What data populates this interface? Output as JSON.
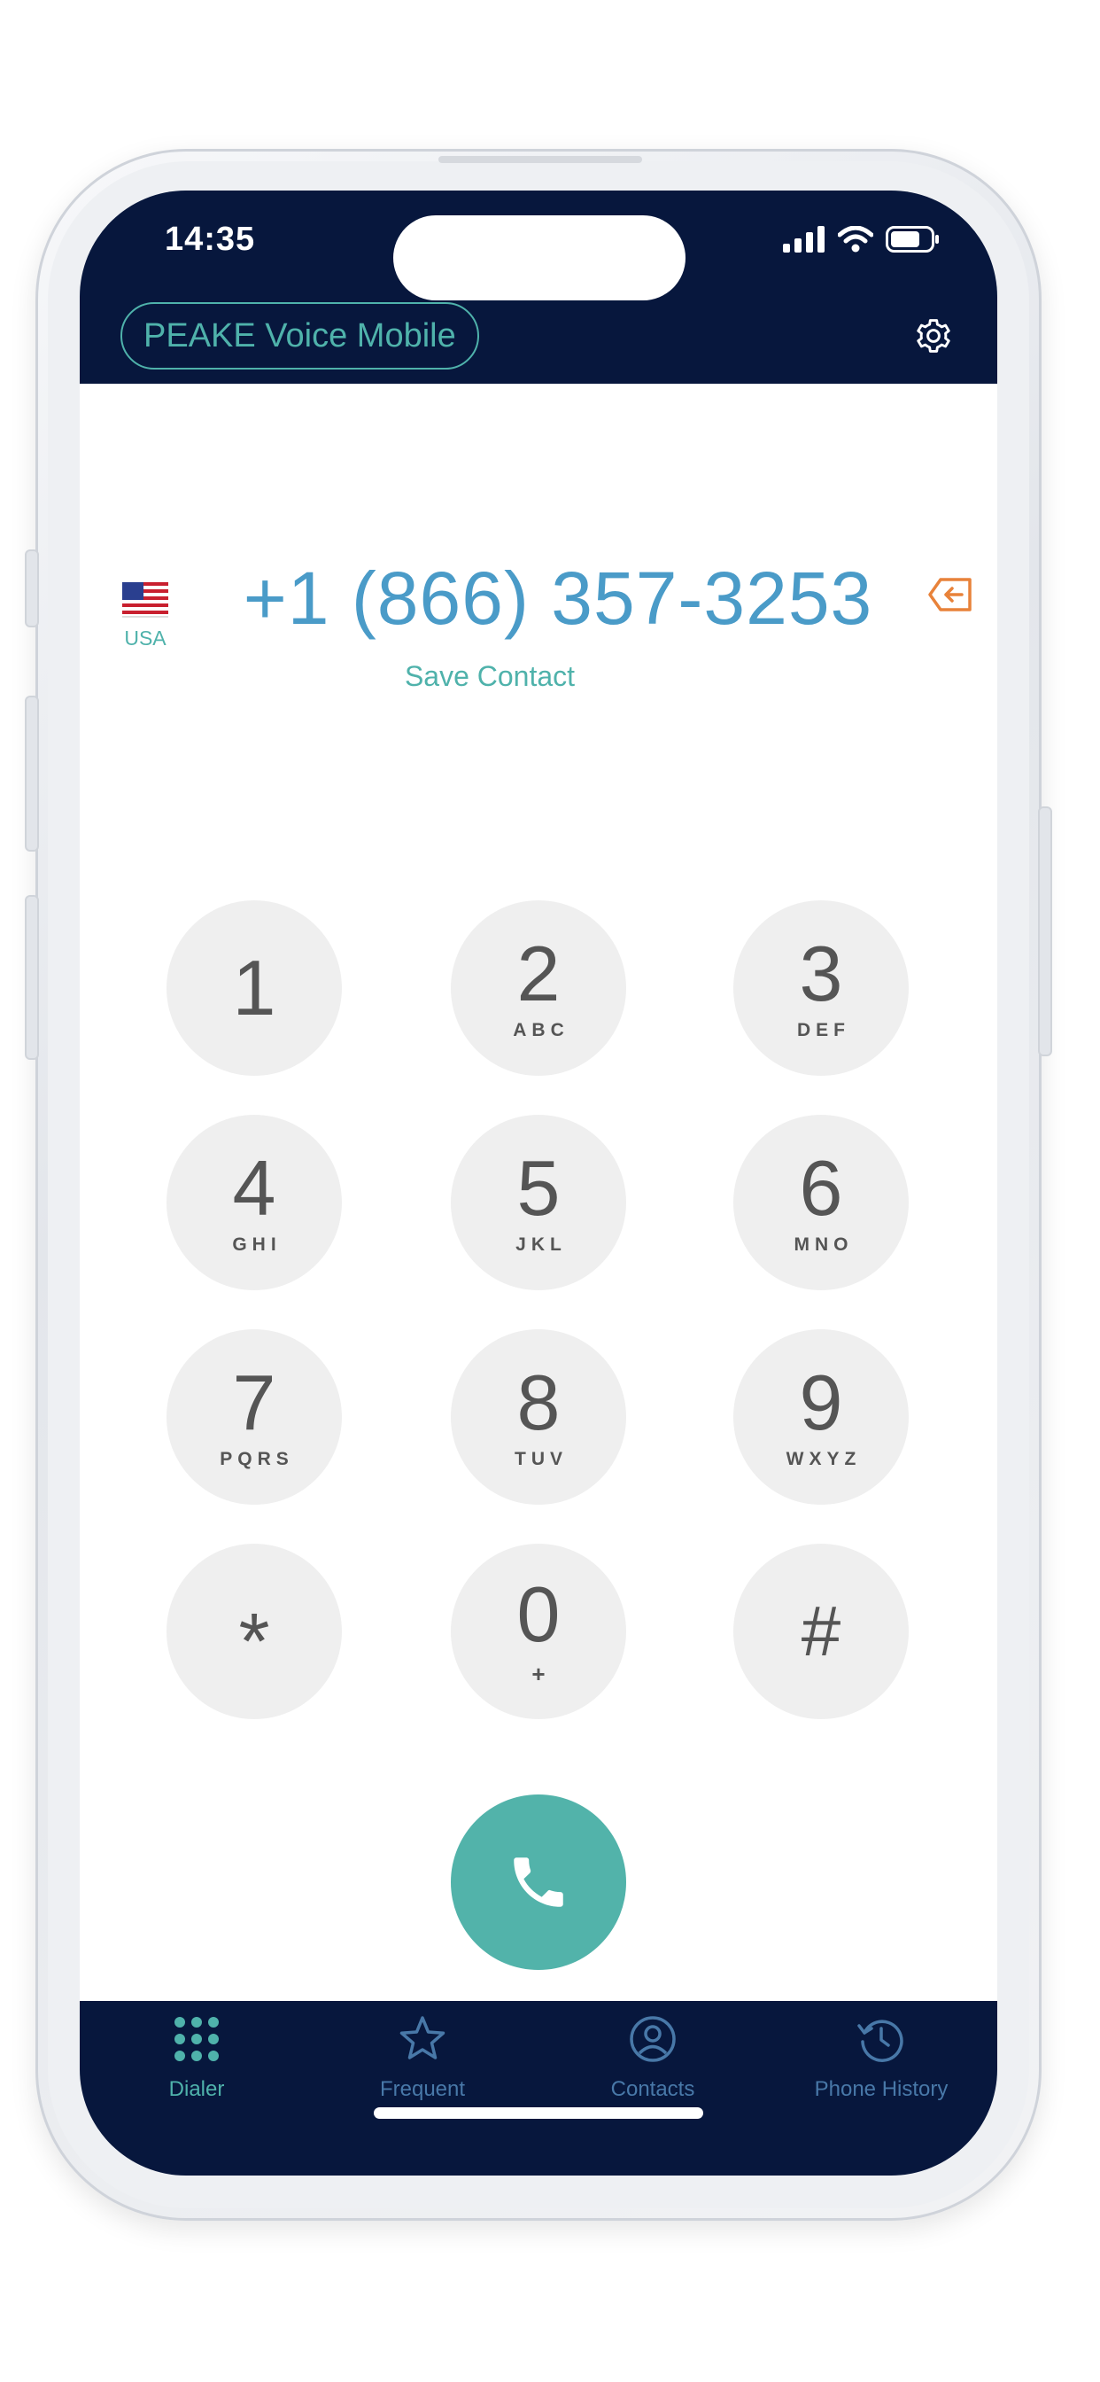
{
  "status_bar": {
    "time": "14:35"
  },
  "header": {
    "app_title": "PEAKE Voice Mobile"
  },
  "dialer": {
    "country_code_label": "USA",
    "number": "+1 (866) 357-3253",
    "save_contact_label": "Save Contact"
  },
  "keypad": [
    {
      "digit": "1",
      "letters": ""
    },
    {
      "digit": "2",
      "letters": "ABC"
    },
    {
      "digit": "3",
      "letters": "DEF"
    },
    {
      "digit": "4",
      "letters": "GHI"
    },
    {
      "digit": "5",
      "letters": "JKL"
    },
    {
      "digit": "6",
      "letters": "MNO"
    },
    {
      "digit": "7",
      "letters": "PQRS"
    },
    {
      "digit": "8",
      "letters": "TUV"
    },
    {
      "digit": "9",
      "letters": "WXYZ"
    },
    {
      "digit": "*",
      "letters": ""
    },
    {
      "digit": "0",
      "letters": "+"
    },
    {
      "digit": "#",
      "letters": ""
    }
  ],
  "bottom_nav": {
    "items": [
      {
        "label": "Dialer",
        "icon": "dialpad-icon",
        "active": true
      },
      {
        "label": "Frequent",
        "icon": "star-icon",
        "active": false
      },
      {
        "label": "Contacts",
        "icon": "person-circle-icon",
        "active": false
      },
      {
        "label": "Phone History",
        "icon": "history-icon",
        "active": false
      }
    ]
  },
  "colors": {
    "header_bg": "#07173d",
    "accent_teal": "#4fb2ab",
    "number_blue": "#4a9bc8",
    "backspace_orange": "#e8823a",
    "key_bg": "#efefef",
    "key_text": "#555555",
    "nav_inactive": "#4878a8"
  }
}
